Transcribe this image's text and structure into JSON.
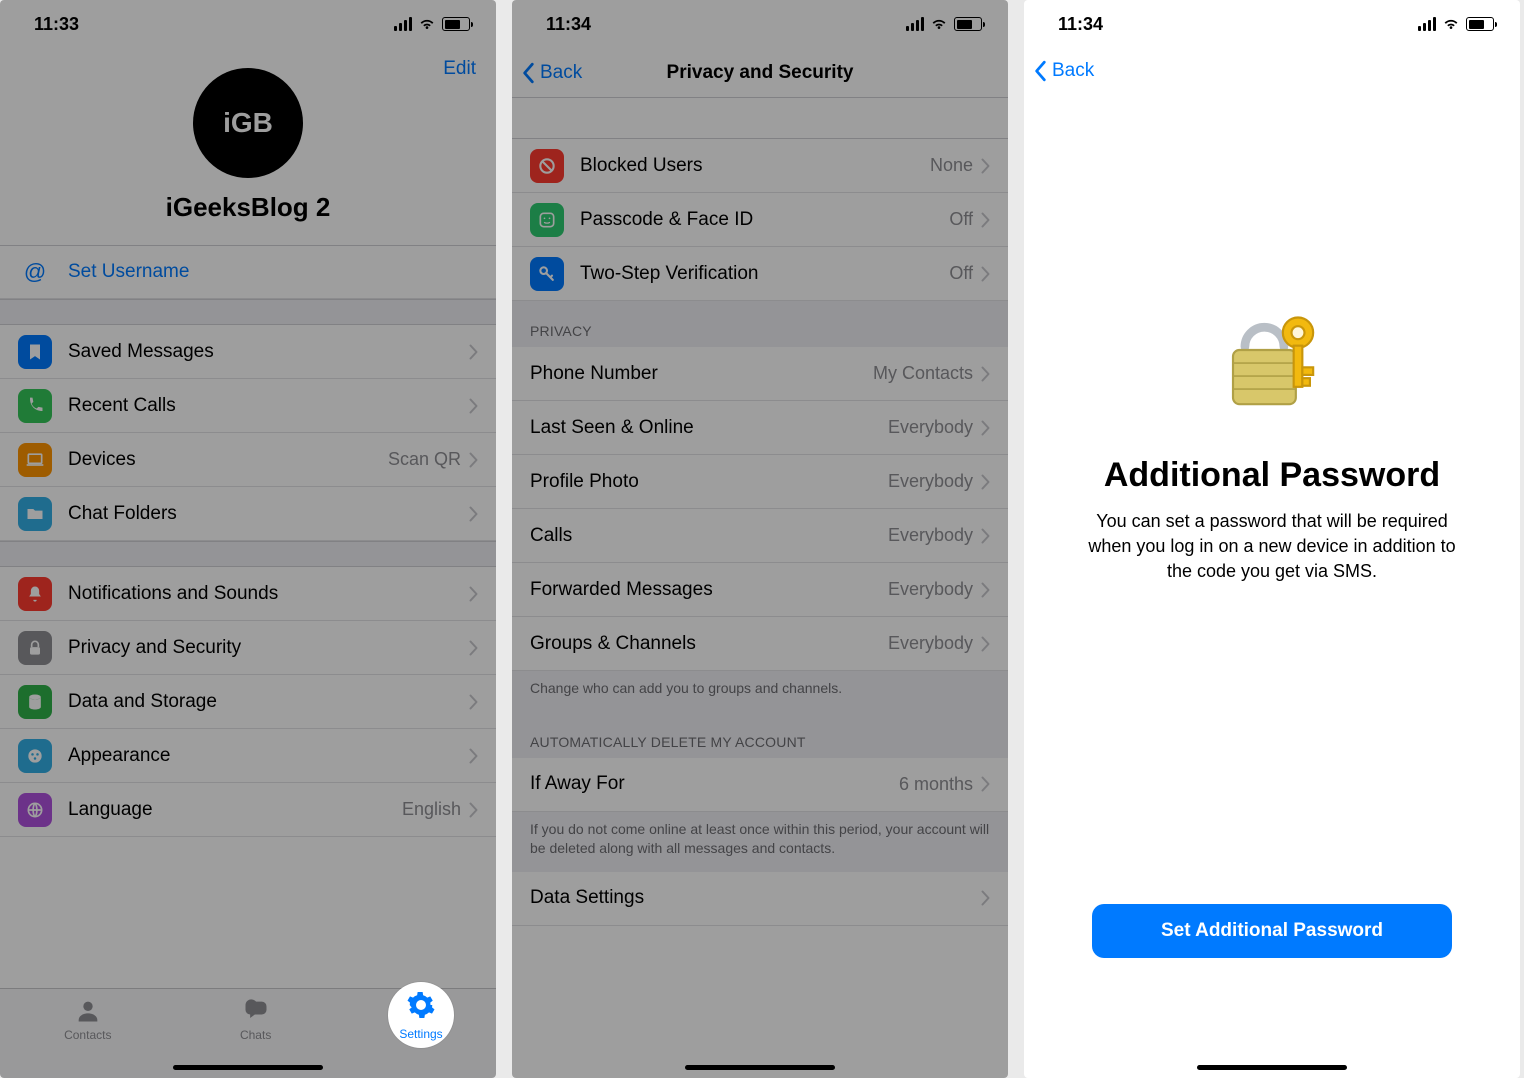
{
  "screen1": {
    "time": "11:33",
    "edit": "Edit",
    "avatar_text": "iGB",
    "profile_name": "iGeeksBlog 2",
    "set_username": "Set Username",
    "rows_a": [
      {
        "label": "Saved Messages",
        "value": "",
        "icon": "bookmark",
        "color": "ic-blue"
      },
      {
        "label": "Recent Calls",
        "value": "",
        "icon": "phone",
        "color": "ic-green"
      },
      {
        "label": "Devices",
        "value": "Scan QR",
        "icon": "laptop",
        "color": "ic-orange"
      },
      {
        "label": "Chat Folders",
        "value": "",
        "icon": "folder",
        "color": "ic-teal"
      }
    ],
    "rows_b": [
      {
        "label": "Notifications and Sounds",
        "value": "",
        "icon": "bell",
        "color": "ic-red"
      },
      {
        "label": "Privacy and Security",
        "value": "",
        "icon": "lock",
        "color": "ic-gray",
        "highlight": true
      },
      {
        "label": "Data and Storage",
        "value": "",
        "icon": "data",
        "color": "ic-dgreen"
      },
      {
        "label": "Appearance",
        "value": "",
        "icon": "brush",
        "color": "ic-teal"
      },
      {
        "label": "Language",
        "value": "English",
        "icon": "globe",
        "color": "ic-purple"
      }
    ],
    "tabs": [
      {
        "label": "Contacts"
      },
      {
        "label": "Chats"
      },
      {
        "label": "Settings",
        "active": true
      }
    ]
  },
  "screen2": {
    "time": "11:34",
    "back": "Back",
    "title": "Privacy and Security",
    "rows_top": [
      {
        "label": "Blocked Users",
        "value": "None",
        "icon": "block",
        "color": "ic-red"
      },
      {
        "label": "Passcode & Face ID",
        "value": "Off",
        "icon": "face",
        "color": "ic-green2"
      },
      {
        "label": "Two-Step Verification",
        "value": "Off",
        "icon": "key",
        "color": "ic-blue",
        "highlight": true
      }
    ],
    "privacy_header": "PRIVACY",
    "rows_privacy": [
      {
        "label": "Phone Number",
        "value": "My Contacts"
      },
      {
        "label": "Last Seen & Online",
        "value": "Everybody"
      },
      {
        "label": "Profile Photo",
        "value": "Everybody"
      },
      {
        "label": "Calls",
        "value": "Everybody"
      },
      {
        "label": "Forwarded Messages",
        "value": "Everybody"
      },
      {
        "label": "Groups & Channels",
        "value": "Everybody"
      }
    ],
    "privacy_footer": "Change who can add you to groups and channels.",
    "auto_header": "AUTOMATICALLY DELETE MY ACCOUNT",
    "rows_auto": [
      {
        "label": "If Away For",
        "value": "6 months"
      }
    ],
    "auto_footer": "If you do not come online at least once within this period, your account will be deleted along with all messages and contacts.",
    "data_settings": "Data Settings"
  },
  "screen3": {
    "time": "11:34",
    "back": "Back",
    "title": "Additional Password",
    "description": "You can set a password that will be required when you log in on a new device in addition to the code you get via SMS.",
    "button": "Set Additional Password"
  }
}
